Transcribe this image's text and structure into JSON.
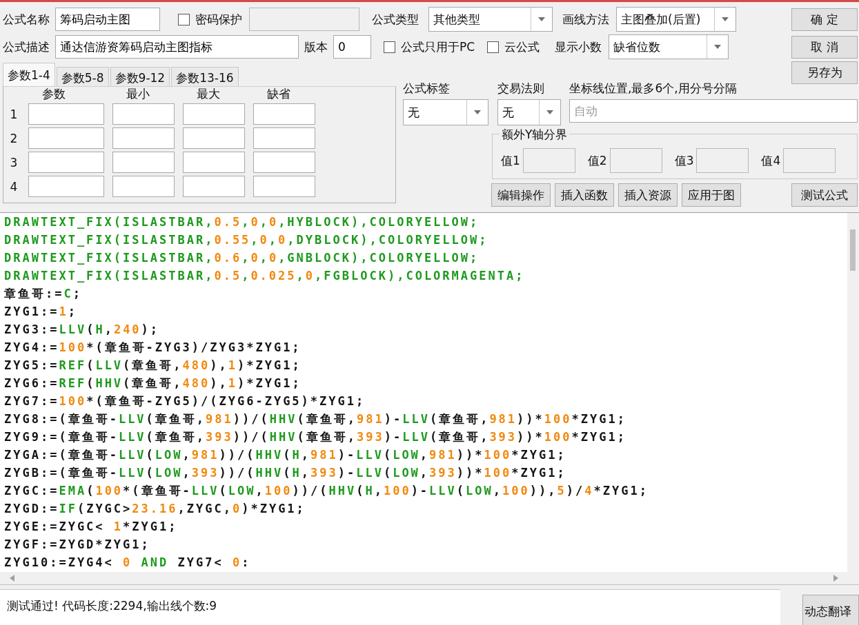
{
  "form": {
    "name_label": "公式名称",
    "name_value": "筹码启动主图",
    "password": {
      "label": "密码保护",
      "checked": false
    },
    "type_label": "公式类型",
    "type_value": "其他类型",
    "draw_label": "画线方法",
    "draw_value": "主图叠加(后置)",
    "desc_label": "公式描述",
    "desc_value": "通达信游资筹码启动主图指标",
    "version_label": "版本",
    "version_value": "0",
    "pc_only": {
      "label": "公式只用于PC",
      "checked": false
    },
    "cloud": {
      "label": "云公式",
      "checked": false
    },
    "decimals_label": "显示小数",
    "decimals_value": "缺省位数"
  },
  "buttons": [
    "确 定",
    "取 消",
    "另存为"
  ],
  "param_tabs": [
    {
      "label": "参数1-4",
      "selected": true
    },
    {
      "label": "参数5-8",
      "selected": false
    },
    {
      "label": "参数9-12",
      "selected": false
    },
    {
      "label": "参数13-16",
      "selected": false
    }
  ],
  "param_columns": [
    "参数",
    "最小",
    "最大",
    "缺省"
  ],
  "param_rows": [
    "1",
    "2",
    "3",
    "4"
  ],
  "tag": {
    "label": "公式标签",
    "value": "无"
  },
  "rule": {
    "label": "交易法则",
    "value": "无"
  },
  "axis": {
    "label": "坐标线位置,最多6个,用分号分隔",
    "placeholder": "自动"
  },
  "y_bounds": {
    "title": "额外Y轴分界",
    "values": [
      "值1",
      "值2",
      "值3",
      "值4"
    ]
  },
  "tool_buttons": [
    "编辑操作",
    "插入函数",
    "插入资源",
    "应用于图",
    "测试公式"
  ],
  "code_lines": [
    [
      {
        "kind": "fn",
        "text": "DRAWTEXT_FIX(ISLASTBAR,"
      },
      {
        "kind": "num",
        "text": "0.5"
      },
      {
        "kind": "fn",
        "text": ","
      },
      {
        "kind": "num",
        "text": "0"
      },
      {
        "kind": "fn",
        "text": ","
      },
      {
        "kind": "num",
        "text": "0"
      },
      {
        "kind": "fn",
        "text": ",HYBLOCK),COLORYELLOW;"
      }
    ],
    [
      {
        "kind": "fn",
        "text": "DRAWTEXT_FIX(ISLASTBAR,"
      },
      {
        "kind": "num",
        "text": "0.55"
      },
      {
        "kind": "fn",
        "text": ","
      },
      {
        "kind": "num",
        "text": "0"
      },
      {
        "kind": "fn",
        "text": ","
      },
      {
        "kind": "num",
        "text": "0"
      },
      {
        "kind": "fn",
        "text": ",DYBLOCK),COLORYELLOW;"
      }
    ],
    [
      {
        "kind": "fn",
        "text": "DRAWTEXT_FIX(ISLASTBAR,"
      },
      {
        "kind": "num",
        "text": "0.6"
      },
      {
        "kind": "fn",
        "text": ","
      },
      {
        "kind": "num",
        "text": "0"
      },
      {
        "kind": "fn",
        "text": ","
      },
      {
        "kind": "num",
        "text": "0"
      },
      {
        "kind": "fn",
        "text": ",GNBLOCK),COLORYELLOW;"
      }
    ],
    [
      {
        "kind": "fn",
        "text": "DRAWTEXT_FIX(ISLASTBAR,"
      },
      {
        "kind": "num",
        "text": "0.5"
      },
      {
        "kind": "fn",
        "text": ","
      },
      {
        "kind": "num",
        "text": "0.025"
      },
      {
        "kind": "fn",
        "text": ","
      },
      {
        "kind": "num",
        "text": "0"
      },
      {
        "kind": "fn",
        "text": ",FGBLOCK),COLORMAGENTA;"
      }
    ],
    [
      {
        "kind": "plain",
        "text": "章鱼哥:="
      },
      {
        "kind": "fn",
        "text": "C"
      },
      {
        "kind": "plain",
        "text": ";"
      }
    ],
    [
      {
        "kind": "plain",
        "text": "ZYG1:="
      },
      {
        "kind": "num",
        "text": "1"
      },
      {
        "kind": "plain",
        "text": ";"
      }
    ],
    [
      {
        "kind": "plain",
        "text": "ZYG3:="
      },
      {
        "kind": "fn",
        "text": "LLV"
      },
      {
        "kind": "plain",
        "text": "("
      },
      {
        "kind": "fn",
        "text": "H"
      },
      {
        "kind": "plain",
        "text": ","
      },
      {
        "kind": "num",
        "text": "240"
      },
      {
        "kind": "plain",
        "text": ");"
      }
    ],
    [
      {
        "kind": "plain",
        "text": "ZYG4:="
      },
      {
        "kind": "num",
        "text": "100"
      },
      {
        "kind": "plain",
        "text": "*(章鱼哥-ZYG3)/ZYG3*ZYG1;"
      }
    ],
    [
      {
        "kind": "plain",
        "text": "ZYG5:="
      },
      {
        "kind": "fn",
        "text": "REF"
      },
      {
        "kind": "plain",
        "text": "("
      },
      {
        "kind": "fn",
        "text": "LLV"
      },
      {
        "kind": "plain",
        "text": "(章鱼哥,"
      },
      {
        "kind": "num",
        "text": "480"
      },
      {
        "kind": "plain",
        "text": "),"
      },
      {
        "kind": "num",
        "text": "1"
      },
      {
        "kind": "plain",
        "text": ")*ZYG1;"
      }
    ],
    [
      {
        "kind": "plain",
        "text": "ZYG6:="
      },
      {
        "kind": "fn",
        "text": "REF"
      },
      {
        "kind": "plain",
        "text": "("
      },
      {
        "kind": "fn",
        "text": "HHV"
      },
      {
        "kind": "plain",
        "text": "(章鱼哥,"
      },
      {
        "kind": "num",
        "text": "480"
      },
      {
        "kind": "plain",
        "text": "),"
      },
      {
        "kind": "num",
        "text": "1"
      },
      {
        "kind": "plain",
        "text": ")*ZYG1;"
      }
    ],
    [
      {
        "kind": "plain",
        "text": "ZYG7:="
      },
      {
        "kind": "num",
        "text": "100"
      },
      {
        "kind": "plain",
        "text": "*(章鱼哥-ZYG5)/(ZYG6-ZYG5)*ZYG1;"
      }
    ],
    [
      {
        "kind": "plain",
        "text": "ZYG8:=(章鱼哥-"
      },
      {
        "kind": "fn",
        "text": "LLV"
      },
      {
        "kind": "plain",
        "text": "(章鱼哥,"
      },
      {
        "kind": "num",
        "text": "981"
      },
      {
        "kind": "plain",
        "text": "))/("
      },
      {
        "kind": "fn",
        "text": "HHV"
      },
      {
        "kind": "plain",
        "text": "(章鱼哥,"
      },
      {
        "kind": "num",
        "text": "981"
      },
      {
        "kind": "plain",
        "text": ")-"
      },
      {
        "kind": "fn",
        "text": "LLV"
      },
      {
        "kind": "plain",
        "text": "(章鱼哥,"
      },
      {
        "kind": "num",
        "text": "981"
      },
      {
        "kind": "plain",
        "text": "))*"
      },
      {
        "kind": "num",
        "text": "100"
      },
      {
        "kind": "plain",
        "text": "*ZYG1;"
      }
    ],
    [
      {
        "kind": "plain",
        "text": "ZYG9:=(章鱼哥-"
      },
      {
        "kind": "fn",
        "text": "LLV"
      },
      {
        "kind": "plain",
        "text": "(章鱼哥,"
      },
      {
        "kind": "num",
        "text": "393"
      },
      {
        "kind": "plain",
        "text": "))/("
      },
      {
        "kind": "fn",
        "text": "HHV"
      },
      {
        "kind": "plain",
        "text": "(章鱼哥,"
      },
      {
        "kind": "num",
        "text": "393"
      },
      {
        "kind": "plain",
        "text": ")-"
      },
      {
        "kind": "fn",
        "text": "LLV"
      },
      {
        "kind": "plain",
        "text": "(章鱼哥,"
      },
      {
        "kind": "num",
        "text": "393"
      },
      {
        "kind": "plain",
        "text": "))*"
      },
      {
        "kind": "num",
        "text": "100"
      },
      {
        "kind": "plain",
        "text": "*ZYG1;"
      }
    ],
    [
      {
        "kind": "plain",
        "text": "ZYGA:=(章鱼哥-"
      },
      {
        "kind": "fn",
        "text": "LLV"
      },
      {
        "kind": "plain",
        "text": "("
      },
      {
        "kind": "fn",
        "text": "LOW"
      },
      {
        "kind": "plain",
        "text": ","
      },
      {
        "kind": "num",
        "text": "981"
      },
      {
        "kind": "plain",
        "text": "))/("
      },
      {
        "kind": "fn",
        "text": "HHV"
      },
      {
        "kind": "plain",
        "text": "("
      },
      {
        "kind": "fn",
        "text": "H"
      },
      {
        "kind": "plain",
        "text": ","
      },
      {
        "kind": "num",
        "text": "981"
      },
      {
        "kind": "plain",
        "text": ")-"
      },
      {
        "kind": "fn",
        "text": "LLV"
      },
      {
        "kind": "plain",
        "text": "("
      },
      {
        "kind": "fn",
        "text": "LOW"
      },
      {
        "kind": "plain",
        "text": ","
      },
      {
        "kind": "num",
        "text": "981"
      },
      {
        "kind": "plain",
        "text": "))*"
      },
      {
        "kind": "num",
        "text": "100"
      },
      {
        "kind": "plain",
        "text": "*ZYG1;"
      }
    ],
    [
      {
        "kind": "plain",
        "text": "ZYGB:=(章鱼哥-"
      },
      {
        "kind": "fn",
        "text": "LLV"
      },
      {
        "kind": "plain",
        "text": "("
      },
      {
        "kind": "fn",
        "text": "LOW"
      },
      {
        "kind": "plain",
        "text": ","
      },
      {
        "kind": "num",
        "text": "393"
      },
      {
        "kind": "plain",
        "text": "))/("
      },
      {
        "kind": "fn",
        "text": "HHV"
      },
      {
        "kind": "plain",
        "text": "("
      },
      {
        "kind": "fn",
        "text": "H"
      },
      {
        "kind": "plain",
        "text": ","
      },
      {
        "kind": "num",
        "text": "393"
      },
      {
        "kind": "plain",
        "text": ")-"
      },
      {
        "kind": "fn",
        "text": "LLV"
      },
      {
        "kind": "plain",
        "text": "("
      },
      {
        "kind": "fn",
        "text": "LOW"
      },
      {
        "kind": "plain",
        "text": ","
      },
      {
        "kind": "num",
        "text": "393"
      },
      {
        "kind": "plain",
        "text": "))*"
      },
      {
        "kind": "num",
        "text": "100"
      },
      {
        "kind": "plain",
        "text": "*ZYG1;"
      }
    ],
    [
      {
        "kind": "plain",
        "text": "ZYGC:="
      },
      {
        "kind": "fn",
        "text": "EMA"
      },
      {
        "kind": "plain",
        "text": "("
      },
      {
        "kind": "num",
        "text": "100"
      },
      {
        "kind": "plain",
        "text": "*(章鱼哥-"
      },
      {
        "kind": "fn",
        "text": "LLV"
      },
      {
        "kind": "plain",
        "text": "("
      },
      {
        "kind": "fn",
        "text": "LOW"
      },
      {
        "kind": "plain",
        "text": ","
      },
      {
        "kind": "num",
        "text": "100"
      },
      {
        "kind": "plain",
        "text": "))/("
      },
      {
        "kind": "fn",
        "text": "HHV"
      },
      {
        "kind": "plain",
        "text": "("
      },
      {
        "kind": "fn",
        "text": "H"
      },
      {
        "kind": "plain",
        "text": ","
      },
      {
        "kind": "num",
        "text": "100"
      },
      {
        "kind": "plain",
        "text": ")-"
      },
      {
        "kind": "fn",
        "text": "LLV"
      },
      {
        "kind": "plain",
        "text": "("
      },
      {
        "kind": "fn",
        "text": "LOW"
      },
      {
        "kind": "plain",
        "text": ","
      },
      {
        "kind": "num",
        "text": "100"
      },
      {
        "kind": "plain",
        "text": ")),"
      },
      {
        "kind": "num",
        "text": "5"
      },
      {
        "kind": "plain",
        "text": ")/"
      },
      {
        "kind": "num",
        "text": "4"
      },
      {
        "kind": "plain",
        "text": "*ZYG1;"
      }
    ],
    [
      {
        "kind": "plain",
        "text": "ZYGD:="
      },
      {
        "kind": "fn",
        "text": "IF"
      },
      {
        "kind": "plain",
        "text": "(ZYGC>"
      },
      {
        "kind": "num",
        "text": "23.16"
      },
      {
        "kind": "plain",
        "text": ",ZYGC,"
      },
      {
        "kind": "num",
        "text": "0"
      },
      {
        "kind": "plain",
        "text": ")*ZYG1;"
      }
    ],
    [
      {
        "kind": "plain",
        "text": "ZYGE:=ZYGC< "
      },
      {
        "kind": "num",
        "text": "1"
      },
      {
        "kind": "plain",
        "text": "*ZYG1;"
      }
    ],
    [
      {
        "kind": "plain",
        "text": "ZYGF:=ZYGD*ZYG1;"
      }
    ],
    [
      {
        "kind": "plain",
        "text": "ZYG10:=ZYG4< "
      },
      {
        "kind": "num",
        "text": "0"
      },
      {
        "kind": "fn",
        "text": " AND"
      },
      {
        "kind": "plain",
        "text": " ZYG7< "
      },
      {
        "kind": "num",
        "text": "0"
      },
      {
        "kind": "plain",
        "text": ":"
      }
    ]
  ],
  "status": {
    "message": "测试通过! 代码长度:2294,输出线个数:9",
    "button": "动态翻译"
  }
}
